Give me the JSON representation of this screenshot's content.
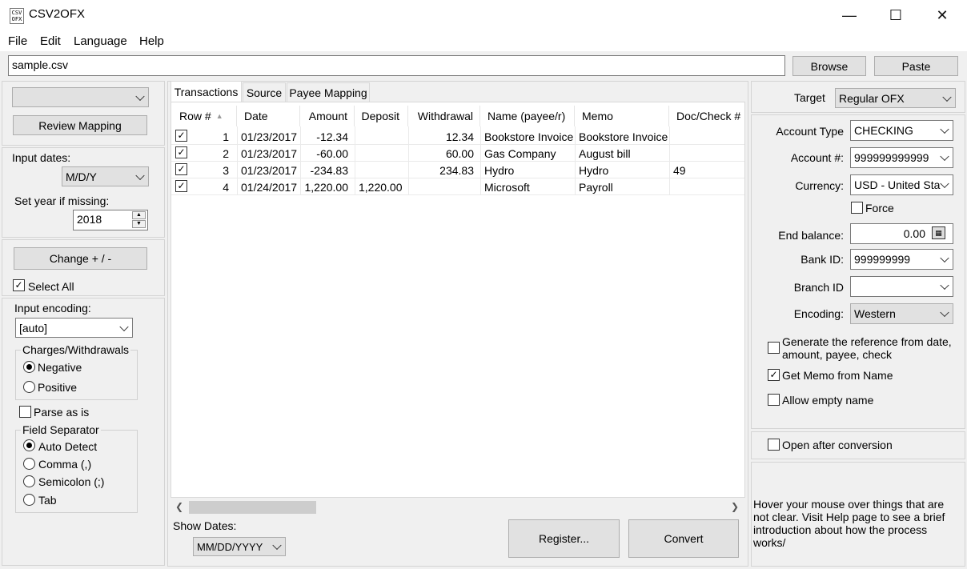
{
  "window": {
    "title": "CSV2OFX",
    "icon_text": "CSV OFX",
    "minimize": "—",
    "maximize": "☐",
    "close": "✕"
  },
  "menu": [
    "File",
    "Edit",
    "Language",
    "Help"
  ],
  "file": {
    "path": "sample.csv",
    "browse": "Browse",
    "paste": "Paste"
  },
  "left": {
    "profile_value": "",
    "review_mapping": "Review Mapping",
    "input_dates_label": "Input dates:",
    "input_dates_value": "M/D/Y",
    "set_year_label": "Set year if missing:",
    "year_value": "2018",
    "change_sign": "Change + / -",
    "select_all": "Select All",
    "input_encoding_label": "Input encoding:",
    "input_encoding_value": "[auto]",
    "charges_title": "Charges/Withdrawals",
    "negative": "Negative",
    "positive": "Positive",
    "parse_as_is": "Parse as is",
    "separator_title": "Field Separator",
    "auto_detect": "Auto Detect",
    "comma": "Comma (,)",
    "semicolon": "Semicolon (;)",
    "tab": "Tab"
  },
  "tabs": [
    "Transactions",
    "Source",
    "Payee Mapping"
  ],
  "table": {
    "headers": [
      "Row #",
      "Date",
      "Amount",
      "Deposit",
      "Withdrawal",
      "Name (payee/r)",
      "Memo",
      "Doc/Check #"
    ],
    "rows": [
      {
        "num": "1",
        "date": "01/23/2017",
        "amount": "-12.34",
        "deposit": "",
        "withdrawal": "12.34",
        "name": "Bookstore Invoice",
        "memo": "Bookstore Invoice",
        "doc": ""
      },
      {
        "num": "2",
        "date": "01/23/2017",
        "amount": "-60.00",
        "deposit": "",
        "withdrawal": "60.00",
        "name": "Gas Company",
        "memo": "August bill",
        "doc": ""
      },
      {
        "num": "3",
        "date": "01/23/2017",
        "amount": "-234.83",
        "deposit": "",
        "withdrawal": "234.83",
        "name": "Hydro",
        "memo": "Hydro",
        "doc": "49"
      },
      {
        "num": "4",
        "date": "01/24/2017",
        "amount": "1,220.00",
        "deposit": "1,220.00",
        "withdrawal": "",
        "name": "Microsoft",
        "memo": "Payroll",
        "doc": ""
      }
    ]
  },
  "bottom": {
    "show_dates_label": "Show Dates:",
    "show_dates_value": "MM/DD/YYYY",
    "register": "Register...",
    "convert": "Convert"
  },
  "right": {
    "target_label": "Target",
    "target_value": "Regular OFX",
    "account_type_label": "Account Type",
    "account_type_value": "CHECKING",
    "account_num_label": "Account #:",
    "account_num_value": "999999999999",
    "currency_label": "Currency:",
    "currency_value": "USD - United Sta",
    "force": "Force",
    "end_balance_label": "End balance:",
    "end_balance_value": "0.00",
    "bank_id_label": "Bank ID:",
    "bank_id_value": "999999999",
    "branch_id_label": "Branch ID",
    "branch_id_value": "",
    "encoding_label": "Encoding:",
    "encoding_value": "Western",
    "gen_ref_line1": "Generate the reference from date,",
    "gen_ref_line2": "amount, payee, check",
    "memo_from_name": "Get Memo from Name",
    "allow_empty": "Allow empty name",
    "open_after": "Open after conversion",
    "help": "Hover your mouse over things that are not clear. Visit Help page to see a brief introduction about how the process works/"
  }
}
